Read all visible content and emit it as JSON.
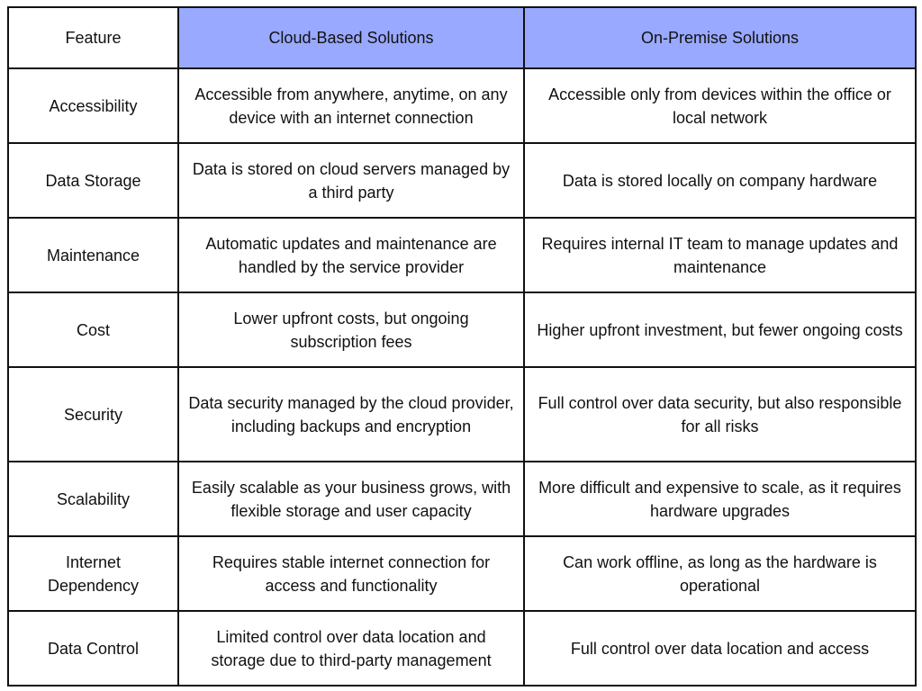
{
  "colors": {
    "header_accent": "#99a9ff",
    "border": "#111111"
  },
  "table": {
    "headers": [
      "Feature",
      "Cloud-Based Solutions",
      "On-Premise Solutions"
    ],
    "rows": [
      {
        "feature": "Accessibility",
        "cloud": "Accessible from anywhere, anytime, on any device with an internet connection",
        "onprem": "Accessible only from devices within the office or local network"
      },
      {
        "feature": "Data Storage",
        "cloud": "Data is stored on cloud servers managed by a third party",
        "onprem": "Data is stored locally on company hardware"
      },
      {
        "feature": "Maintenance",
        "cloud": "Automatic updates and maintenance are handled by the service provider",
        "onprem": "Requires internal IT team to manage updates and maintenance"
      },
      {
        "feature": "Cost",
        "cloud": "Lower upfront costs, but ongoing subscription fees",
        "onprem": "Higher upfront investment, but fewer ongoing costs"
      },
      {
        "feature": "Security",
        "cloud": "Data security managed by the cloud provider, including backups and encryption",
        "onprem": "Full control over data security, but also responsible for all risks"
      },
      {
        "feature": "Scalability",
        "cloud": "Easily scalable as your business grows, with flexible storage and user capacity",
        "onprem": "More difficult and expensive to scale, as it requires hardware upgrades"
      },
      {
        "feature": "Internet Dependency",
        "cloud": "Requires stable internet connection for access and functionality",
        "onprem": "Can work offline, as long as the hardware is operational"
      },
      {
        "feature": "Data Control",
        "cloud": "Limited control over data location and storage due to third-party management",
        "onprem": "Full control over data location and access"
      }
    ]
  }
}
